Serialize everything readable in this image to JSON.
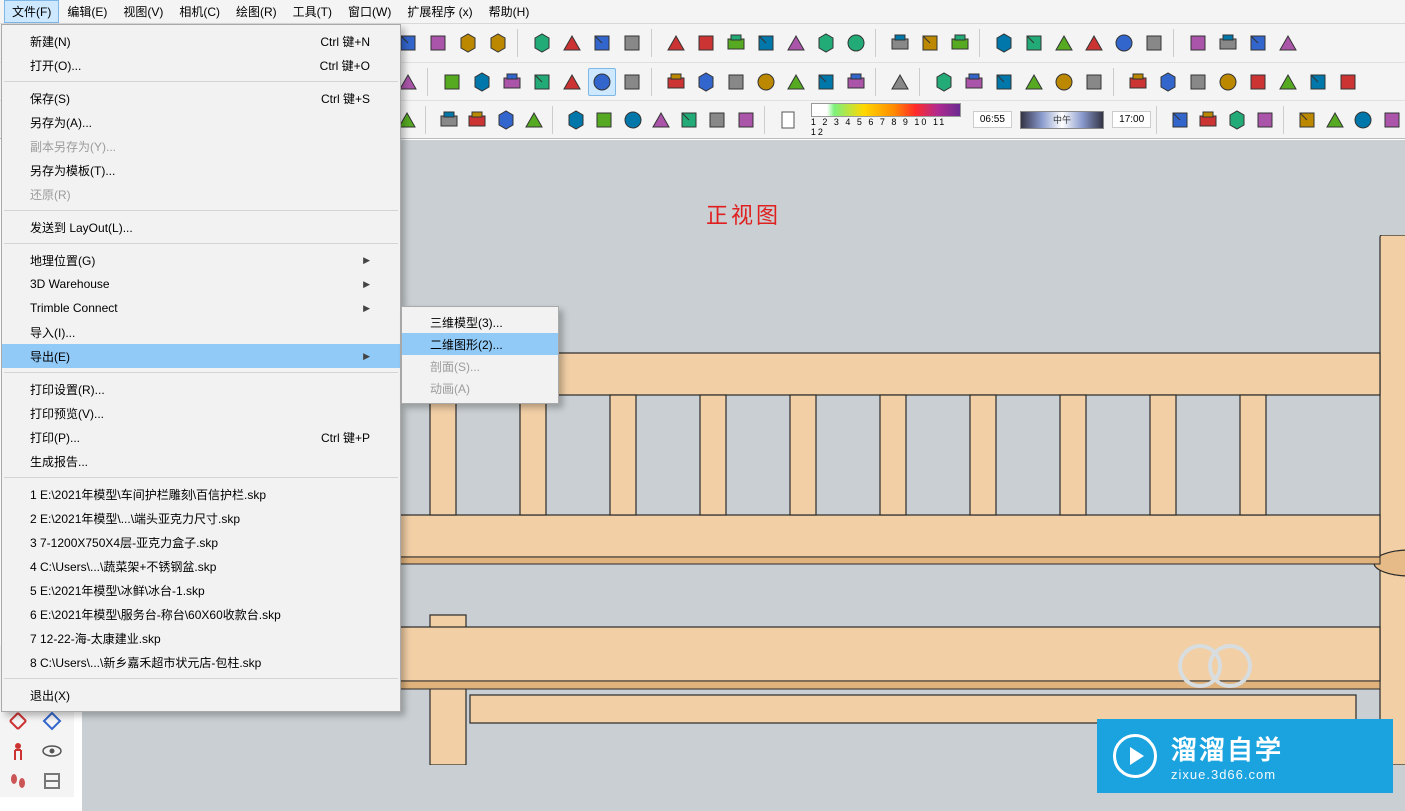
{
  "menubar": {
    "items": [
      {
        "label": "文件(F)",
        "active": true
      },
      {
        "label": "编辑(E)"
      },
      {
        "label": "视图(V)"
      },
      {
        "label": "相机(C)"
      },
      {
        "label": "绘图(R)"
      },
      {
        "label": "工具(T)"
      },
      {
        "label": "窗口(W)"
      },
      {
        "label": "扩展程序 (x)"
      },
      {
        "label": "帮助(H)"
      }
    ]
  },
  "file_menu": {
    "groups": [
      [
        {
          "label": "新建(N)",
          "shortcut": "Ctrl 键+N"
        },
        {
          "label": "打开(O)...",
          "shortcut": "Ctrl 键+O"
        }
      ],
      [
        {
          "label": "保存(S)",
          "shortcut": "Ctrl 键+S"
        },
        {
          "label": "另存为(A)...",
          "shortcut": ""
        },
        {
          "label": "副本另存为(Y)...",
          "shortcut": "",
          "disabled": true
        },
        {
          "label": "另存为模板(T)...",
          "shortcut": ""
        },
        {
          "label": "还原(R)",
          "shortcut": "",
          "disabled": true
        }
      ],
      [
        {
          "label": "发送到 LayOut(L)...",
          "shortcut": ""
        }
      ],
      [
        {
          "label": "地理位置(G)",
          "shortcut": "",
          "arrow": true
        },
        {
          "label": "3D Warehouse",
          "shortcut": "",
          "arrow": true
        },
        {
          "label": "Trimble Connect",
          "shortcut": "",
          "arrow": true
        },
        {
          "label": "导入(I)...",
          "shortcut": ""
        },
        {
          "label": "导出(E)",
          "shortcut": "",
          "arrow": true,
          "highlight": true
        }
      ],
      [
        {
          "label": "打印设置(R)...",
          "shortcut": ""
        },
        {
          "label": "打印预览(V)...",
          "shortcut": ""
        },
        {
          "label": "打印(P)...",
          "shortcut": "Ctrl 键+P"
        },
        {
          "label": "生成报告...",
          "shortcut": ""
        }
      ],
      [
        {
          "label": "1 E:\\2021年模型\\车间护栏雕刻\\百信护栏.skp"
        },
        {
          "label": "2 E:\\2021年模型\\...\\端头亚克力尺寸.skp"
        },
        {
          "label": "3 7-1200X750X4层-亚克力盒子.skp"
        },
        {
          "label": "4 C:\\Users\\...\\蔬菜架+不锈钢盆.skp"
        },
        {
          "label": "5 E:\\2021年模型\\冰鲜\\冰台-1.skp"
        },
        {
          "label": "6 E:\\2021年模型\\服务台-称台\\60X60收款台.skp"
        },
        {
          "label": "7 12-22-海-太康建业.skp"
        },
        {
          "label": "8 C:\\Users\\...\\新乡嘉禾超市状元店-包柱.skp"
        }
      ],
      [
        {
          "label": "退出(X)"
        }
      ]
    ]
  },
  "export_submenu": {
    "items": [
      {
        "label": "三维模型(3)..."
      },
      {
        "label": "二维图形(2)...",
        "highlight": true
      },
      {
        "label": "剖面(S)...",
        "disabled": true
      },
      {
        "label": "动画(A)",
        "disabled": true
      }
    ]
  },
  "viewport": {
    "front_view_label": "正视图"
  },
  "time_bar": {
    "scale_numbers": "1 2 3 4 5 6 7 8 9 10 11 12",
    "time": "06:55",
    "noon_label": "中午",
    "end_time": "17:00"
  },
  "watermark": {
    "title": "溜溜自学",
    "url": "zixue.3d66.com"
  },
  "toolbar_icons": {
    "row1": [
      "map-icon",
      "terrain-icon",
      "tag-icon",
      "note-icon",
      "box1-icon",
      "box2-icon",
      "box3-icon",
      "box4-icon",
      "camera-icon",
      "pan-icon",
      "cam2-icon",
      "cam3-icon",
      "cam4-icon",
      "cam5-icon",
      "nosmoke-icon",
      "arrow-icon",
      "group1-icon",
      "group2-icon",
      "stack-icon",
      "grid-icon",
      "img-icon",
      "img2-icon",
      "img3-icon",
      "img4-icon",
      "cube-icon",
      "nav-icon",
      "check-icon",
      "cloud-icon"
    ],
    "row2": [
      "g",
      "poly1",
      "poly2",
      "poly3",
      "poly4",
      "poly5",
      "poly6",
      "poly7",
      "h1",
      "h2",
      "h3",
      "h4",
      "h5",
      "h6",
      "h7",
      "s",
      "layer1",
      "layer2",
      "layer3",
      "layer4",
      "layer5",
      "layer6",
      "dim1",
      "dim2",
      "dim3",
      "dim4",
      "axis",
      "dim5",
      "dim6",
      "pen"
    ],
    "row3": [
      "iso",
      "sphere",
      "tea1",
      "tea2",
      "cloud",
      "cup",
      "win1",
      "win2",
      "win3",
      "win4",
      "lock",
      "page"
    ]
  }
}
